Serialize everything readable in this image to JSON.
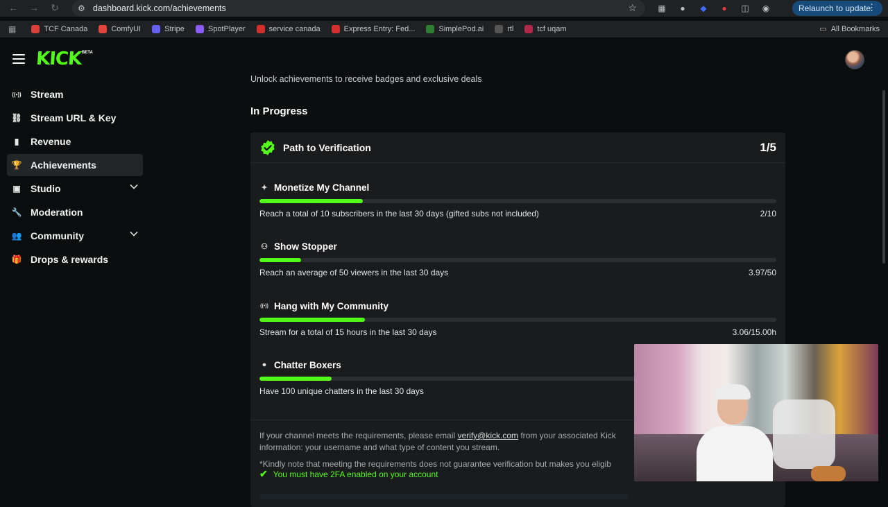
{
  "browser": {
    "url": "dashboard.kick.com/achievements",
    "relaunch_label": "Relaunch to update",
    "bookmarks": [
      {
        "label": "TCF Canada",
        "color": "#d9413a"
      },
      {
        "label": "ComfyUI",
        "color": "#e0443a"
      },
      {
        "label": "Stripe",
        "color": "#6461f2"
      },
      {
        "label": "SpotPlayer",
        "color": "#8b5cf6"
      },
      {
        "label": "service canada",
        "color": "#d32f2f"
      },
      {
        "label": "Express Entry: Fed...",
        "color": "#d32f2f"
      },
      {
        "label": "SimplePod.ai",
        "color": "#2e7d32"
      },
      {
        "label": "rtl",
        "color": "#555555"
      },
      {
        "label": "tcf uqam",
        "color": "#b0284a"
      }
    ],
    "all_bookmarks": "All Bookmarks"
  },
  "header": {
    "logo": "KICK",
    "beta": "BETA"
  },
  "sidebar": {
    "items": [
      {
        "label": "Stream",
        "icon": "broadcast-icon"
      },
      {
        "label": "Stream URL & Key",
        "icon": "link-icon"
      },
      {
        "label": "Revenue",
        "icon": "chart-icon"
      },
      {
        "label": "Achievements",
        "icon": "trophy-icon",
        "active": true
      },
      {
        "label": "Studio",
        "icon": "studio-icon",
        "expandable": true
      },
      {
        "label": "Moderation",
        "icon": "wrench-icon"
      },
      {
        "label": "Community",
        "icon": "community-icon",
        "expandable": true
      },
      {
        "label": "Drops & rewards",
        "icon": "gift-icon"
      }
    ]
  },
  "main": {
    "subtitle": "Unlock achievements to receive badges and exclusive deals",
    "section_title": "In Progress",
    "card": {
      "title": "Path to Verification",
      "count": "1/5",
      "achievements": [
        {
          "title": "Monetize My Channel",
          "icon": "sparkle-icon",
          "desc": "Reach a total of 10 subscribers in the last 30 days (gifted subs not included)",
          "value": "2/10",
          "progress": 0.2
        },
        {
          "title": "Show Stopper",
          "icon": "viewers-icon",
          "desc": "Reach an average of 50 viewers in the last 30 days",
          "value": "3.97/50",
          "progress": 0.08
        },
        {
          "title": "Hang with My Community",
          "icon": "broadcast-icon",
          "desc": "Stream for a total of 15 hours in the last 30 days",
          "value": "3.06/15.00h",
          "progress": 0.204
        },
        {
          "title": "Chatter Boxers",
          "icon": "chat-icon",
          "desc": "Have 100 unique chatters in the last 30 days",
          "value": "",
          "progress": 0.14
        }
      ],
      "note_prefix": "If your channel meets the requirements, please email ",
      "note_email": "verify@kick.com",
      "note_suffix": " from your associated Kick",
      "note_line2": "information: your username and what type of content you stream.",
      "note_line3": "*Kindly note that meeting the requirements does not guarantee verification but makes you eligib",
      "twofa": "You must have 2FA enabled on your account"
    }
  },
  "colors": {
    "accent": "#53fc18",
    "card_bg": "#191b1d",
    "page_bg": "#0b0e0f"
  }
}
